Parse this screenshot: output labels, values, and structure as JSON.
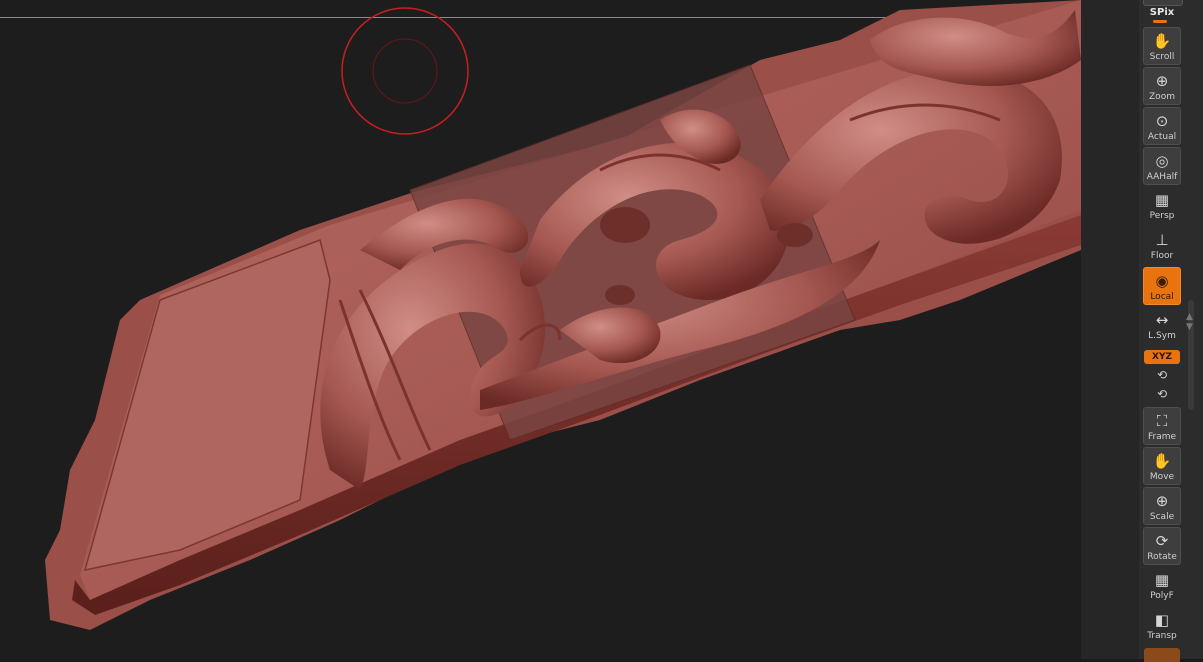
{
  "shelf": {
    "spix_label": "SPix",
    "buttons": [
      {
        "name": "scroll-button",
        "label": "Scroll",
        "icon": "hand-icon",
        "glyph": "✋",
        "active": false
      },
      {
        "name": "zoom-button",
        "label": "Zoom",
        "icon": "magnifier-icon",
        "glyph": "⊕",
        "active": false
      },
      {
        "name": "actual-button",
        "label": "Actual",
        "icon": "magnifier-icon",
        "glyph": "⊙",
        "active": false
      },
      {
        "name": "aahalf-button",
        "label": "AAHalf",
        "icon": "magnifier-icon",
        "glyph": "◎",
        "active": false
      },
      {
        "name": "persp-button",
        "label": "Persp",
        "icon": "grid-icon",
        "glyph": "▦",
        "active": false
      },
      {
        "name": "floor-button",
        "label": "Floor",
        "icon": "floor-icon",
        "glyph": "⊥",
        "active": false
      },
      {
        "name": "local-button",
        "label": "Local",
        "icon": "local-rotate-icon",
        "glyph": "◉",
        "active": true
      },
      {
        "name": "lsym-button",
        "label": "L.Sym",
        "icon": "symmetry-arrows-icon",
        "glyph": "↔",
        "active": false
      },
      {
        "name": "frame-button",
        "label": "Frame",
        "icon": "frame-icon",
        "glyph": "⛶",
        "active": false
      },
      {
        "name": "move-button",
        "label": "Move",
        "icon": "move-hand-icon",
        "glyph": "✋",
        "active": false
      },
      {
        "name": "scale-button",
        "label": "Scale",
        "icon": "scale-icon",
        "glyph": "⊕",
        "active": false
      },
      {
        "name": "rotate-button",
        "label": "Rotate",
        "icon": "rotate-icon",
        "glyph": "⟳",
        "active": false
      },
      {
        "name": "polyf-button",
        "label": "PolyF",
        "icon": "polyframe-icon",
        "glyph": "▦",
        "active": false
      },
      {
        "name": "transp-button",
        "label": "Transp",
        "icon": "transparency-icon",
        "glyph": "◧",
        "active": false
      }
    ],
    "xyz_label": "XYZ",
    "rotate_y_glyph": "⟲",
    "rotate_z_glyph": "⟲"
  },
  "viewport": {
    "brush_cursor_color": "#c81e1e",
    "model_color": "#a85a55"
  }
}
